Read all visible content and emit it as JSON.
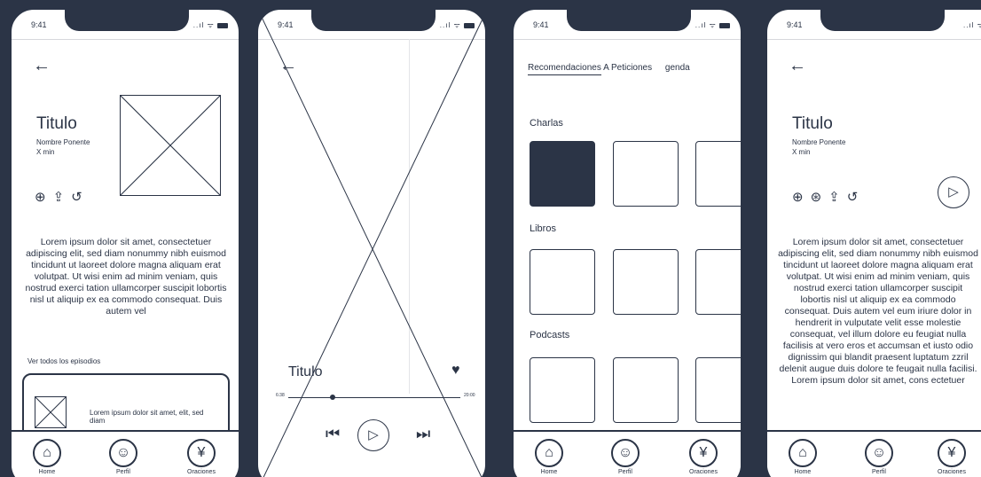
{
  "status": {
    "time": "9:41",
    "signal": "..ıl ᯤ"
  },
  "nav": {
    "home": "Home",
    "profile": "Perfil",
    "prayers": "Oraciones"
  },
  "detail": {
    "back": "←",
    "title": "Titulo",
    "speaker": "Nombre Ponente",
    "duration": "X min",
    "body": "Lorem ipsum dolor sit amet, consectetuer adipiscing elit, sed diam nonummy nibh euismod tincidunt ut laoreet dolore magna aliquam erat volutpat. Ut wisi enim ad minim veniam, quis nostrud exerci tation ullamcorper suscipit lobortis nisl ut aliquip ex ea commodo consequat. Duis autem vel",
    "see_all": "Ver todos los episodios",
    "episode_text": "Lorem ipsum dolor sit amet, elit, sed diam"
  },
  "player": {
    "title": "Titulo",
    "current_time": "6:38",
    "total_time": "20:00",
    "progress": 0.26
  },
  "library": {
    "tabs": [
      "Recomendaciones",
      "A Peticiones",
      "genda"
    ],
    "sections": [
      "Charlas",
      "Libros",
      "Podcasts"
    ]
  },
  "detail2": {
    "title": "Titulo",
    "speaker": "Nombre Ponente",
    "duration": "X min",
    "body": "Lorem ipsum dolor sit amet, consectetuer adipiscing elit, sed diam nonummy nibh euismod tincidunt ut laoreet dolore magna aliquam erat volutpat. Ut wisi enim ad minim veniam, quis nostrud exerci tation ullamcorper suscipit lobortis nisl ut aliquip ex ea commodo consequat. Duis autem vel eum iriure dolor in hendrerit in vulputate velit esse molestie consequat, vel illum dolore eu feugiat nulla facilisis at vero eros et accumsan et iusto odio dignissim qui blandit praesent luptatum zzril delenit augue duis dolore te feugait nulla facilisi. Lorem ipsum dolor sit amet, cons ectetuer"
  }
}
